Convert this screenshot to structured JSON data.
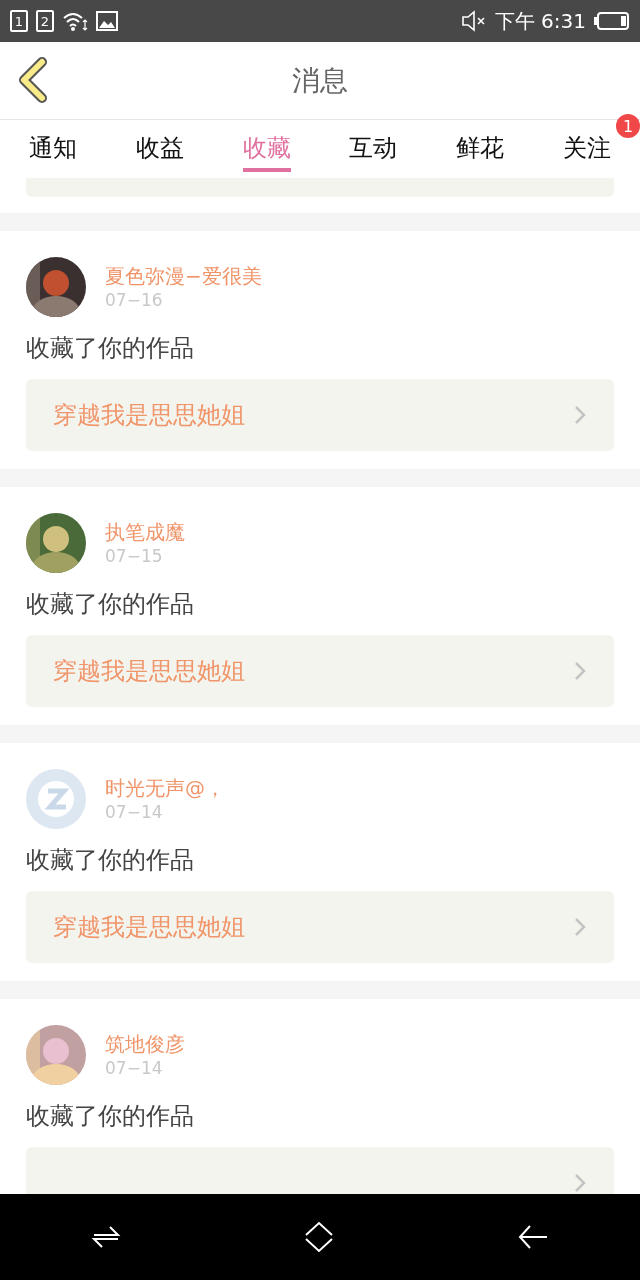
{
  "status_bar": {
    "sim_slots": [
      "1",
      "2"
    ],
    "time": "下午 6:31"
  },
  "header": {
    "title": "消息"
  },
  "tabs": [
    {
      "label": "通知",
      "selected": false
    },
    {
      "label": "收益",
      "selected": false
    },
    {
      "label": "收藏",
      "selected": true
    },
    {
      "label": "互动",
      "selected": false
    },
    {
      "label": "鲜花",
      "selected": false
    },
    {
      "label": "关注",
      "selected": false,
      "badge": "1"
    }
  ],
  "messages": [
    {
      "kind": "picture",
      "name": "夏色弥漫−爱很美",
      "date": "07−16",
      "action": "收藏了你的作品",
      "work": "穿越我是思思她姐"
    },
    {
      "kind": "picture",
      "name": "执笔成魔",
      "date": "07−15",
      "action": "收藏了你的作品",
      "work": "穿越我是思思她姐"
    },
    {
      "kind": "default",
      "name": "时光无声@，",
      "date": "07−14",
      "action": "收藏了你的作品",
      "work": "穿越我是思思她姐"
    },
    {
      "kind": "picture",
      "name": "筑地俊彦",
      "date": "07−14",
      "action": "收藏了你的作品"
    }
  ]
}
